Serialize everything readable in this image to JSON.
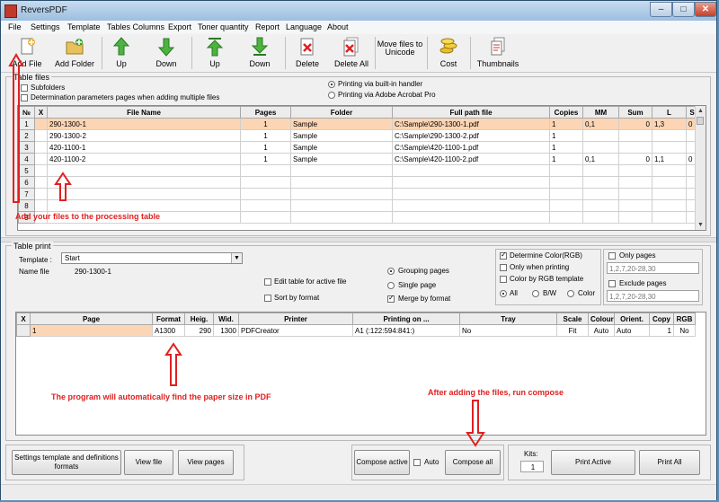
{
  "window": {
    "title": "ReversPDF"
  },
  "menu": [
    "File",
    "Settings",
    "Template",
    "Tables Columns",
    "Export",
    "Toner quantity",
    "Report",
    "Language",
    "About"
  ],
  "toolbar": {
    "add_file": "Add File",
    "add_folder": "Add Folder",
    "up1": "Up",
    "down1": "Down",
    "up2": "Up",
    "down2": "Down",
    "delete": "Delete",
    "delete_all": "Delete All",
    "move_files_1": "Move files to",
    "move_files_2": "Unicode",
    "cost": "Cost",
    "thumbnails": "Thumbnails"
  },
  "table_files": {
    "group_label": "Table files",
    "subfolders": "Subfolders",
    "determination": "Determination parameters pages when adding multiple files",
    "print_builtin": "Printing via built-in handler",
    "print_acrobat": "Printing via Adobe Acrobat Pro",
    "columns": [
      "№",
      "X",
      "File Name",
      "Pages",
      "Folder",
      "Full path file",
      "Copies",
      "MM",
      "Sum",
      "L",
      "S"
    ],
    "rows": [
      {
        "n": "1",
        "file": "290-1300-1",
        "pages": "1",
        "folder": "Sample",
        "path": "C:\\Sample\\290-1300-1.pdf",
        "copies": "1",
        "mm": "0,1",
        "sum": "0",
        "l": "1,3",
        "s": "0"
      },
      {
        "n": "2",
        "file": "290-1300-2",
        "pages": "1",
        "folder": "Sample",
        "path": "C:\\Sample\\290-1300-2.pdf",
        "copies": "1",
        "mm": "",
        "sum": "",
        "l": "",
        "s": ""
      },
      {
        "n": "3",
        "file": "420-1100-1",
        "pages": "1",
        "folder": "Sample",
        "path": "C:\\Sample\\420-1100-1.pdf",
        "copies": "1",
        "mm": "",
        "sum": "",
        "l": "",
        "s": ""
      },
      {
        "n": "4",
        "file": "420-1100-2",
        "pages": "1",
        "folder": "Sample",
        "path": "C:\\Sample\\420-1100-2.pdf",
        "copies": "1",
        "mm": "0,1",
        "sum": "0",
        "l": "1,1",
        "s": "0"
      },
      {
        "n": "5",
        "file": "",
        "pages": "",
        "folder": "",
        "path": "",
        "copies": "",
        "mm": "",
        "sum": "",
        "l": "",
        "s": ""
      },
      {
        "n": "6",
        "file": "",
        "pages": "",
        "folder": "",
        "path": "",
        "copies": "",
        "mm": "",
        "sum": "",
        "l": "",
        "s": ""
      },
      {
        "n": "7",
        "file": "",
        "pages": "",
        "folder": "",
        "path": "",
        "copies": "",
        "mm": "",
        "sum": "",
        "l": "",
        "s": ""
      },
      {
        "n": "8",
        "file": "",
        "pages": "",
        "folder": "",
        "path": "",
        "copies": "",
        "mm": "",
        "sum": "",
        "l": "",
        "s": ""
      },
      {
        "n": "9",
        "file": "",
        "pages": "",
        "folder": "",
        "path": "",
        "copies": "",
        "mm": "",
        "sum": "",
        "l": "",
        "s": ""
      }
    ]
  },
  "table_print": {
    "group_label": "Table print",
    "template_label": "Template :",
    "template_value": "Start",
    "name_file_label": "Name file",
    "name_file_value": "290-1300-1",
    "edit_table": "Edit table for active file",
    "sort_format": "Sort by format",
    "grouping": "Grouping pages",
    "single": "Single page",
    "merge": "Merge by format",
    "determine_color": "Determine Color(RGB)",
    "only_printing": "Only when printing",
    "color_rgb": "Color by RGB template",
    "all": "All",
    "bw": "B/W",
    "color": "Color",
    "only_pages": "Only pages",
    "only_pages_ph": "1,2,7,20-28,30",
    "exclude_pages": "Exclude pages",
    "exclude_pages_ph": "1,2,7,20-28,30",
    "columns": [
      "X",
      "Page",
      "Format",
      "Heig.",
      "Wid.",
      "Printer",
      "Printing on ...",
      "Tray",
      "Scale",
      "Colour",
      "Orient.",
      "Copy",
      "RGB"
    ],
    "rows": [
      {
        "x": "",
        "page": "1",
        "format": "A1300",
        "heig": "290",
        "wid": "1300",
        "printer": "PDFCreator",
        "printing_on": "A1 (:122:594:841:)",
        "tray": "No",
        "scale": "Fit",
        "colour": "Auto",
        "orient": "Auto",
        "copy": "1",
        "rgb": "No"
      }
    ]
  },
  "bottom": {
    "settings_btn_1": "Settings template and definitions",
    "settings_btn_2": "formats",
    "view_file": "View file",
    "view_pages": "View pages",
    "compose_active": "Compose active",
    "auto": "Auto",
    "compose_all": "Compose all",
    "kits_label": "Kits:",
    "kits_value": "1",
    "print_active": "Print Active",
    "print_all": "Print All"
  },
  "annotations": {
    "add_files": "Add your files to the processing table",
    "auto_find": "The program will automatically find the paper size in PDF",
    "run_compose": "After adding the files, run compose"
  },
  "colors": {
    "annotation": "#e02020",
    "selected_row": "#fcd5b4",
    "title_bar": "#9cbfe0"
  }
}
